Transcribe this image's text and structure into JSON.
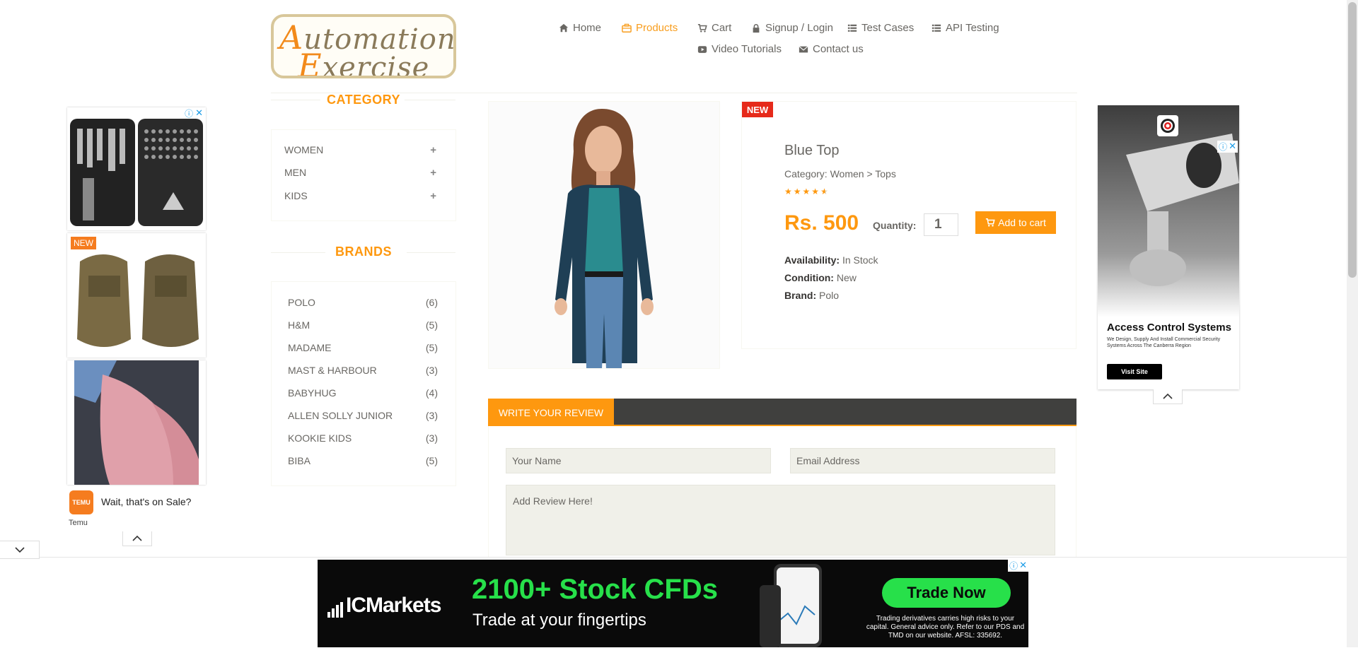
{
  "header": {
    "logo_line1": "Automation",
    "logo_line2": "Exercise",
    "nav": [
      {
        "label": "Home",
        "icon": "home-icon"
      },
      {
        "label": "Products",
        "icon": "products-icon",
        "active": true
      },
      {
        "label": "Cart",
        "icon": "cart-icon"
      },
      {
        "label": "Signup / Login",
        "icon": "lock-icon"
      },
      {
        "label": "Test Cases",
        "icon": "list-icon"
      },
      {
        "label": "API Testing",
        "icon": "list-icon"
      },
      {
        "label": "Video Tutorials",
        "icon": "video-icon"
      },
      {
        "label": "Contact us",
        "icon": "envelope-icon"
      }
    ]
  },
  "sidebar": {
    "category_title": "CATEGORY",
    "categories": [
      "WOMEN",
      "MEN",
      "KIDS"
    ],
    "brands_title": "BRANDS",
    "brands": [
      {
        "name": "POLO",
        "count": "(6)"
      },
      {
        "name": "H&M",
        "count": "(5)"
      },
      {
        "name": "MADAME",
        "count": "(5)"
      },
      {
        "name": "MAST & HARBOUR",
        "count": "(3)"
      },
      {
        "name": "BABYHUG",
        "count": "(4)"
      },
      {
        "name": "ALLEN SOLLY JUNIOR",
        "count": "(3)"
      },
      {
        "name": "KOOKIE KIDS",
        "count": "(3)"
      },
      {
        "name": "BIBA",
        "count": "(5)"
      }
    ]
  },
  "product": {
    "badge": "NEW",
    "name": "Blue Top",
    "category": "Category: Women > Tops",
    "rating": 4.5,
    "price": "Rs. 500",
    "quantity_label": "Quantity:",
    "quantity_value": "1",
    "add_to_cart": "Add to cart",
    "availability_label": "Availability:",
    "availability": "In Stock",
    "condition_label": "Condition:",
    "condition": "New",
    "brand_label": "Brand:",
    "brand": "Polo"
  },
  "review": {
    "tab_label": "WRITE YOUR REVIEW",
    "name_placeholder": "Your Name",
    "email_placeholder": "Email Address",
    "review_placeholder": "Add Review Here!"
  },
  "ads": {
    "left": {
      "badge": "NEW",
      "tagline": "Wait, that's on Sale?",
      "brand": "Temu",
      "logo_text": "TEMU"
    },
    "right": {
      "title": "Access Control Systems",
      "body": "We Design, Supply And Install Commercial Security Systems Across The Canberra Region",
      "button": "Visit Site"
    },
    "bottom": {
      "brand": "ICMarkets",
      "headline": "2100+ Stock CFDs",
      "subline": "Trade at your fingertips",
      "button": "Trade Now",
      "disclaimer": "Trading derivatives carries high risks to your capital. General advice only. Refer to our PDS and TMD on our website. AFSL: 335692."
    }
  },
  "colors": {
    "accent": "#FE980F",
    "text": "#696763",
    "new_badge": "#E62A1A",
    "review_bar": "#40403E",
    "input_bg": "#F0F0E9",
    "ad_green": "#27E04A"
  }
}
